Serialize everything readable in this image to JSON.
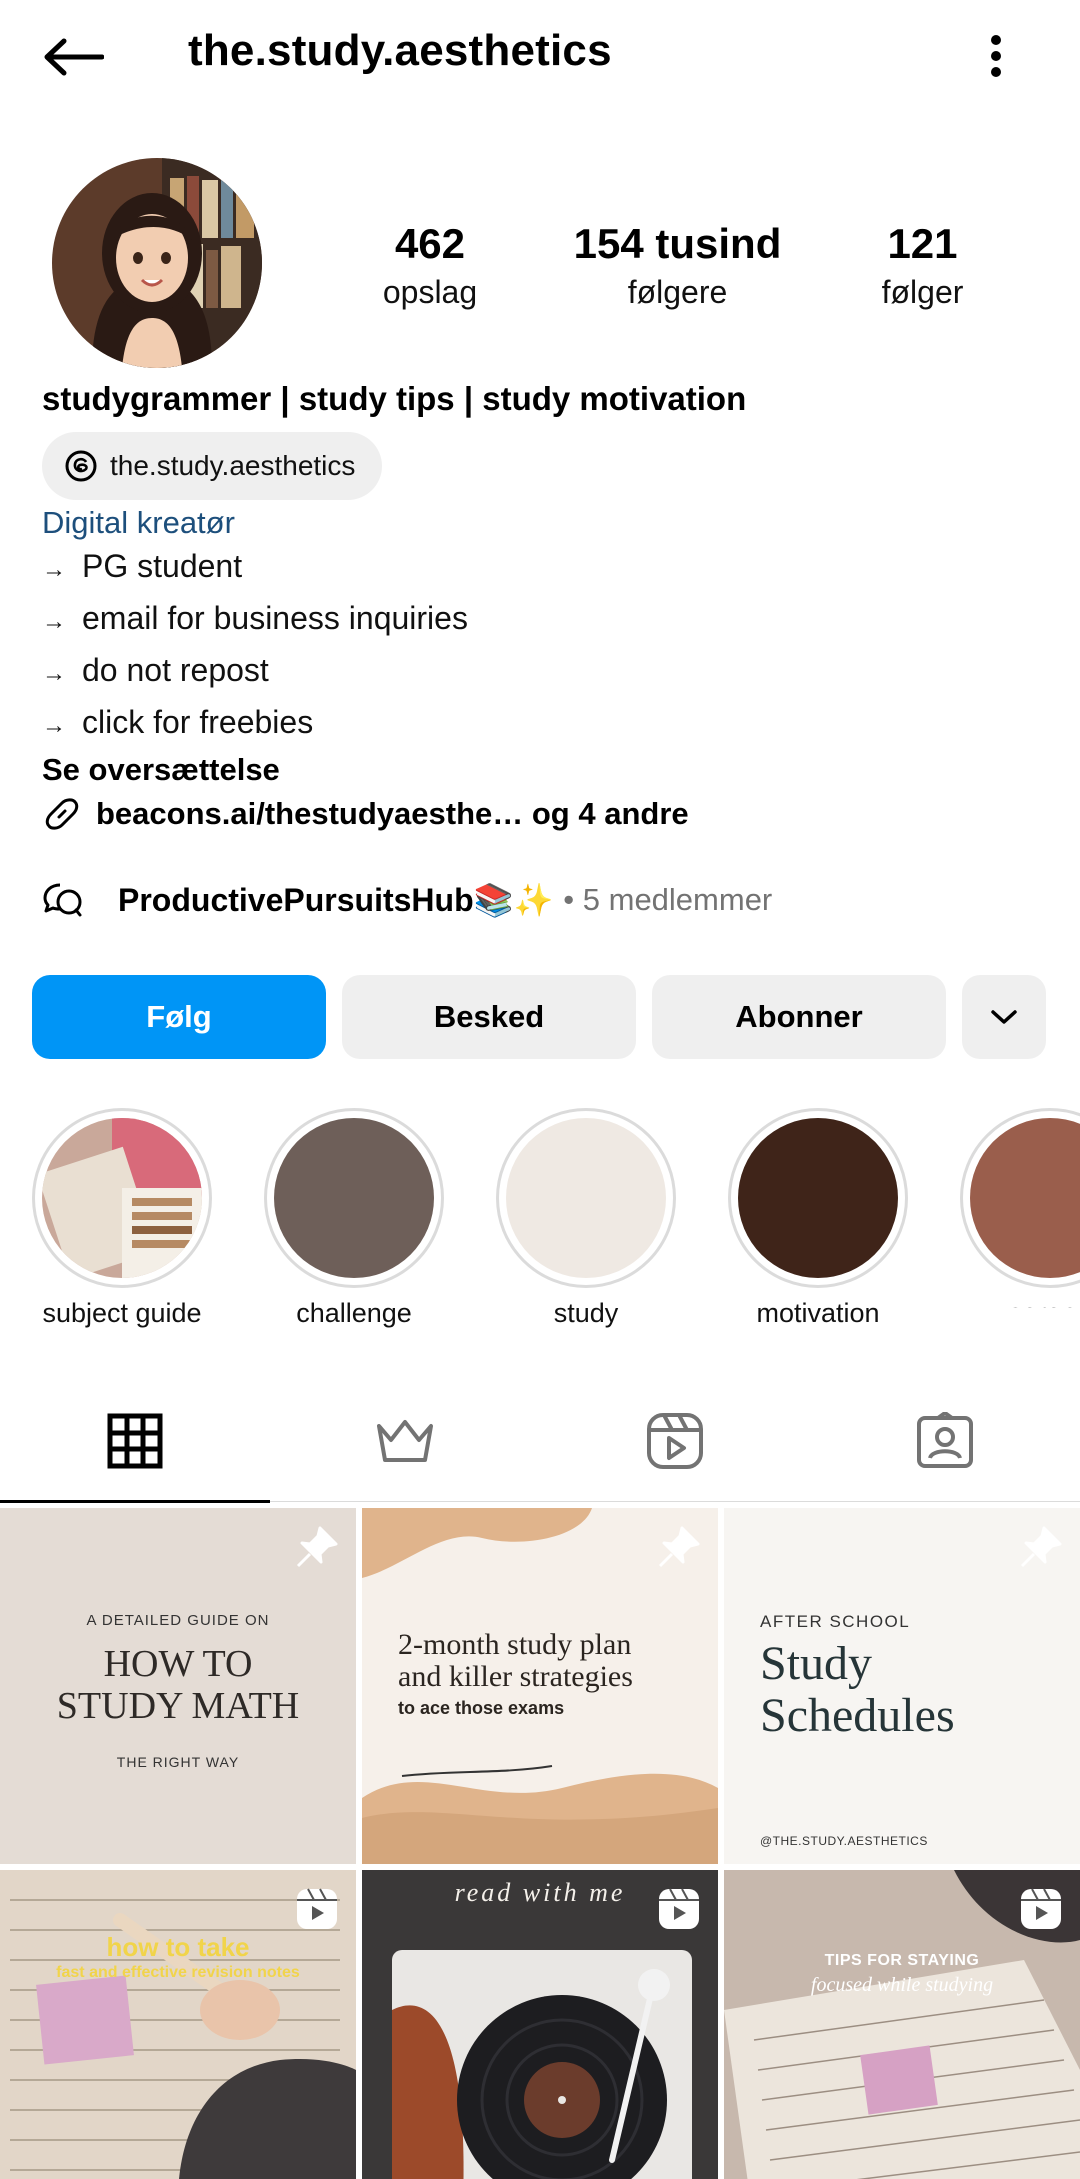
{
  "header": {
    "username": "the.study.aesthetics"
  },
  "stats": {
    "posts_count": "462",
    "posts_label": "opslag",
    "followers_count": "154 tusind",
    "followers_label": "følgere",
    "following_count": "121",
    "following_label": "følger"
  },
  "bio": {
    "name": "studygrammer | study tips | study motivation",
    "threads_handle": "the.study.aesthetics",
    "category": "Digital kreatør",
    "lines": [
      "PG student",
      "email for business inquiries",
      "do not repost",
      "click for freebies"
    ],
    "arrow": "→",
    "translate": "Se oversættelse",
    "link": "beacons.ai/thestudyaesthe… og 4 andre"
  },
  "channel": {
    "name": "ProductivePursuitsHub📚✨",
    "members": "• 5 medlemmer"
  },
  "buttons": {
    "follow": "Følg",
    "message": "Besked",
    "subscribe": "Abonner"
  },
  "highlights": [
    "subject guide",
    "challenge",
    "study",
    "motivation",
    "serene"
  ],
  "highlight_colors": [
    "#c9a89a",
    "#6e5f59",
    "#efe9e3",
    "#3f2419",
    "#9a5e4c"
  ],
  "tabs": [
    "posts-grid-icon",
    "subscriber-crown-icon",
    "reels-icon",
    "tagged-icon"
  ],
  "posts": {
    "p1": {
      "kicker": "A DETAILED GUIDE ON",
      "title1": "HOW TO",
      "title2": "STUDY MATH",
      "footer": "THE RIGHT WAY"
    },
    "p2": {
      "line1": "2-month study plan",
      "line2": "and killer strategies",
      "line3": "to ace those exams"
    },
    "p3": {
      "kicker": "AFTER SCHOOL",
      "title1": "Study",
      "title2": "Schedules",
      "handle": "@THE.STUDY.AESTHETICS"
    },
    "p4": {
      "line1": "how to take",
      "line2": "fast and effective revision notes"
    },
    "p5": {
      "line1": "read with me"
    },
    "p6": {
      "line1": "TIPS FOR STAYING",
      "line2": "focused while studying"
    }
  },
  "colors": {
    "accent": "#0095f6",
    "category": "#1d4f7c",
    "muted": "#737373",
    "pill_bg": "#efefef"
  }
}
